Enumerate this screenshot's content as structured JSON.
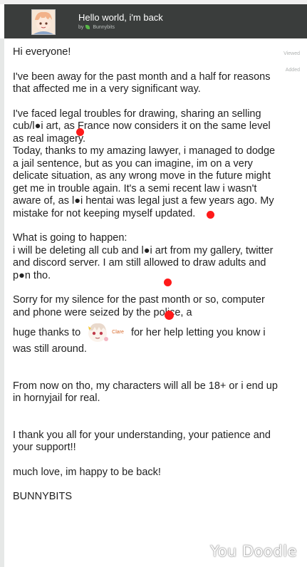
{
  "header": {
    "title": "Hello world, i'm back",
    "by_prefix": "by",
    "author": "Bunnybits"
  },
  "sidebar": {
    "viewed_label": "Viewed",
    "added_label": "Added"
  },
  "post": {
    "greeting": "Hi everyone!",
    "para1": "I've been away for the past month and a half for reasons that affected me in a very significant way.",
    "para2": "I've faced legal troubles for drawing, sharing an selling cub/l●i art, as France now considers it on the same level as real imagery.",
    "para3": "Today, thanks to my amazing lawyer, i managed to dodge a jail sentence, but as you can imagine, im on a very delicate situation, as any wrong move in the future might get me in trouble again. It's a semi recent law i wasn't aware of, as l●i hentai was legal just a few years ago. My mistake for not keeping myself updated.",
    "para4a": "What is going to happen:",
    "para4b": "i will be deleting all cub and l●i art from my gallery, twitter and discord server. I am still allowed to draw adults and p●n tho.",
    "para5a": "Sorry for my silence for the past month or so, computer and phone were seized by the police, a",
    "para5b_before": "huge thanks to",
    "para5b_name": "Clare",
    "para5b_after": "for her help letting you know i was still around.",
    "para6": "From now on tho, my characters will all be 18+ or i end up in hornyjail for real.",
    "para7": "I thank you all for your understanding, your patience and your support!!",
    "para8": "much love, im happy to be back!",
    "signature": "BUNNYBITS"
  },
  "watermark": "You Doodle",
  "icons": {
    "avatar": "author-avatar",
    "author_icon": "leaf-icon",
    "emote": "user-emote-icon"
  },
  "colors": {
    "header_bg": "#3a3d3c",
    "text": "#222222",
    "censor": "#ff1a1a",
    "mention": "#d96a2c"
  }
}
